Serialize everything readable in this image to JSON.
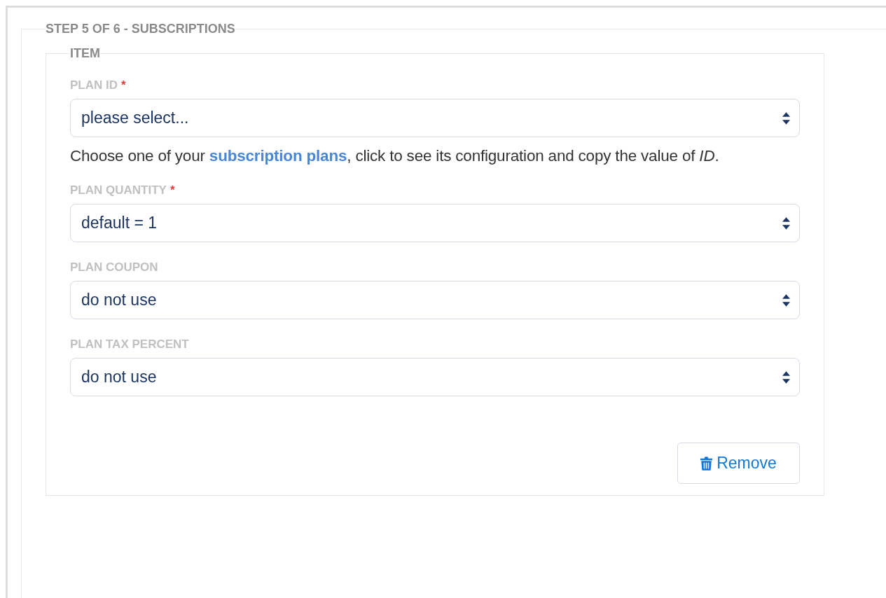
{
  "step_section": {
    "legend": "STEP 5 OF 6 - SUBSCRIPTIONS",
    "item": {
      "legend": "ITEM",
      "fields": [
        {
          "label": "PLAN ID",
          "required_mark": "*",
          "value": "please select...",
          "help": {
            "before": "Choose one of your ",
            "link": "subscription plans",
            "after": ", click to see its configuration and copy the value of *ID*."
          }
        },
        {
          "label": "PLAN QUANTITY",
          "required_mark": "*",
          "value": "default = 1"
        },
        {
          "label": "PLAN COUPON",
          "value": "do not use"
        },
        {
          "label": "PLAN TAX PERCENT",
          "value": "do not use"
        }
      ],
      "remove_button": "Remove"
    }
  }
}
